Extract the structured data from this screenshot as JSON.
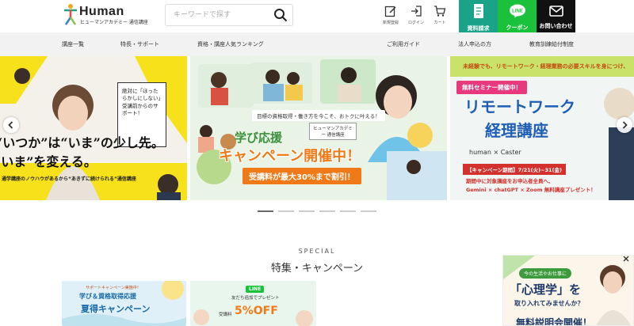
{
  "header": {
    "logo_word": "Human",
    "logo_sub": "ヒューマンアカデミー 通信講座",
    "search_placeholder": "キーワードで探す",
    "icons": [
      {
        "label": "新規登録",
        "icon": "edit-icon"
      },
      {
        "label": "ログイン",
        "icon": "login-icon"
      },
      {
        "label": "カート",
        "icon": "cart-icon"
      }
    ],
    "cta": [
      {
        "label": "資料請求",
        "icon": "document-icon",
        "color": "#1aa389"
      },
      {
        "label": "クーポン",
        "icon": "line-icon",
        "color": "#19c23a",
        "badge": "LINE"
      },
      {
        "label": "お問い合わせ",
        "icon": "mail-icon",
        "color": "#111111"
      }
    ]
  },
  "nav": [
    "講座一覧",
    "特長・サポート",
    "資格・講座人気ランキング",
    "ご利用ガイド",
    "法人申込の方",
    "教育訓練給付制度"
  ],
  "slides": {
    "left": {
      "bubble": "絶対に「ほったらかしにしない」受講前からのサポート！",
      "catch1": "“いつか”は“いま”の少し先。",
      "catch2": "“いま”を変える。",
      "bottom": "通学講座のノウハウがあるから“あきずに続けられる”通信講座"
    },
    "center": {
      "top": "目標の資格取得・働き方を今こそ、おトクに叶える！",
      "tag": "ヒューマンアカデミー 通信講座",
      "title1": "学び応援",
      "title2": "キャンペーン開催中！",
      "sub": "受講料が最大30%まで割引！"
    },
    "right": {
      "top": "未経験でも、リモートワーク・経理業務の必要スキルを身につけ、",
      "badge": "無料セミナー開催中！",
      "title1": "リモートワーク",
      "title2": "経理講座",
      "partner": "human × Caster",
      "period": "【キャンペーン期間】7/21(火)~31(金)",
      "note1": "期間中に対象講座をお申込者全員へ、",
      "note2": "Gemini × chatGPT × Zoom 無料講座プレゼント！"
    }
  },
  "dots_count": 6,
  "dots_active": 0,
  "special": {
    "label": "SPECIAL",
    "title": "特集・キャンペーン",
    "cards": [
      {
        "top": "サポートキャンペーン実施中！",
        "title1": "学び＆資格取得応援",
        "title2": "夏得キャンペーン"
      },
      {
        "line": "LINE",
        "sub": "友だち追加でプレゼント",
        "small": "受講料",
        "big": "5%OFF"
      }
    ]
  },
  "popup": {
    "top": "今の生活やお仕事に",
    "big": "「心理学」を",
    "line2": "取り入れてみませんか？",
    "bottom": "無料説明会開催！"
  },
  "colors": {
    "nav_bg": "#f2f2f2",
    "accent_orange": "#f07a18",
    "right_blue": "#1f5eb5"
  }
}
